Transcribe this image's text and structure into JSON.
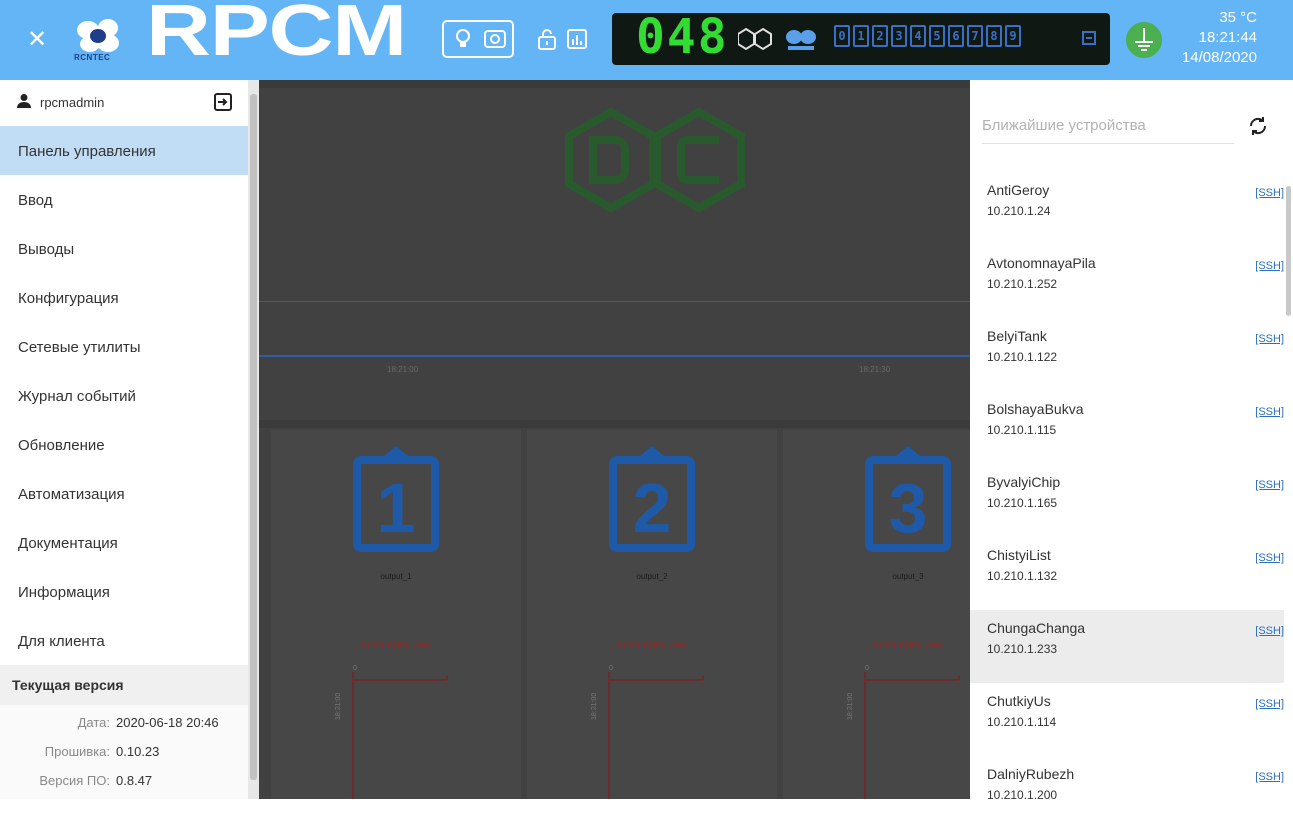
{
  "header": {
    "brand": "RCNTEC",
    "title": "RPCM",
    "counter": "048",
    "temperature": "35 °C",
    "time": "18:21:44",
    "date": "14/08/2020",
    "port_indicators": [
      "0",
      "1",
      "2",
      "3",
      "4",
      "5",
      "6",
      "7",
      "8",
      "9"
    ],
    "colors": {
      "bar": "#64b5f6",
      "display_bg": "#101814",
      "display_green": "#32dc32",
      "ground": "#4caf50"
    }
  },
  "sidebar": {
    "user": "rpcmadmin",
    "nav": [
      {
        "label": "Панель управления",
        "active": true
      },
      {
        "label": "Ввод"
      },
      {
        "label": "Выводы"
      },
      {
        "label": "Конфигурация"
      },
      {
        "label": "Сетевые утилиты"
      },
      {
        "label": "Журнал событий"
      },
      {
        "label": "Обновление"
      },
      {
        "label": "Автоматизация"
      },
      {
        "label": "Документация"
      },
      {
        "label": "Информация"
      },
      {
        "label": "Для клиента"
      }
    ],
    "version": {
      "heading": "Текущая версия",
      "rows": [
        {
          "key": "Дата:",
          "value": "2020-06-18 20:46"
        },
        {
          "key": "Прошивка:",
          "value": "0.10.23"
        },
        {
          "key": "Версия ПО:",
          "value": "0.8.47"
        }
      ]
    }
  },
  "main": {
    "time_ticks": [
      "18:21:00",
      "18:21:30"
    ],
    "outputs": [
      {
        "name": "output_1",
        "number": "1",
        "current": "СИЛА ТОКА: 0 мА",
        "zero": "0",
        "time": "18:21:00"
      },
      {
        "name": "output_2",
        "number": "2",
        "current": "СИЛА ТОКА: 0 мА",
        "zero": "0",
        "time": "18:21:00"
      },
      {
        "name": "output_3",
        "number": "3",
        "current": "СИЛА ТОКА: 0 мА",
        "zero": "0",
        "time": "18:21:00"
      }
    ],
    "colors": {
      "overlay": "#414141",
      "output_icon": "#1e5aa8",
      "current_text": "#8a2a2a"
    }
  },
  "devices": {
    "search_placeholder": "Ближайшие устройства",
    "link_label": "[SSH]",
    "items": [
      {
        "name": "AntiGeroy",
        "ip": "10.210.1.24"
      },
      {
        "name": "AvtonomnayaPila",
        "ip": "10.210.1.252"
      },
      {
        "name": "BelyiTank",
        "ip": "10.210.1.122"
      },
      {
        "name": "BolshayaBukva",
        "ip": "10.210.1.115"
      },
      {
        "name": "ByvalyiChip",
        "ip": "10.210.1.165"
      },
      {
        "name": "ChistyiList",
        "ip": "10.210.1.132"
      },
      {
        "name": "ChungaChanga",
        "ip": "10.210.1.233",
        "selected": true
      },
      {
        "name": "ChutkiyUs",
        "ip": "10.210.1.114"
      },
      {
        "name": "DalniyRubezh",
        "ip": "10.210.1.200"
      }
    ]
  }
}
